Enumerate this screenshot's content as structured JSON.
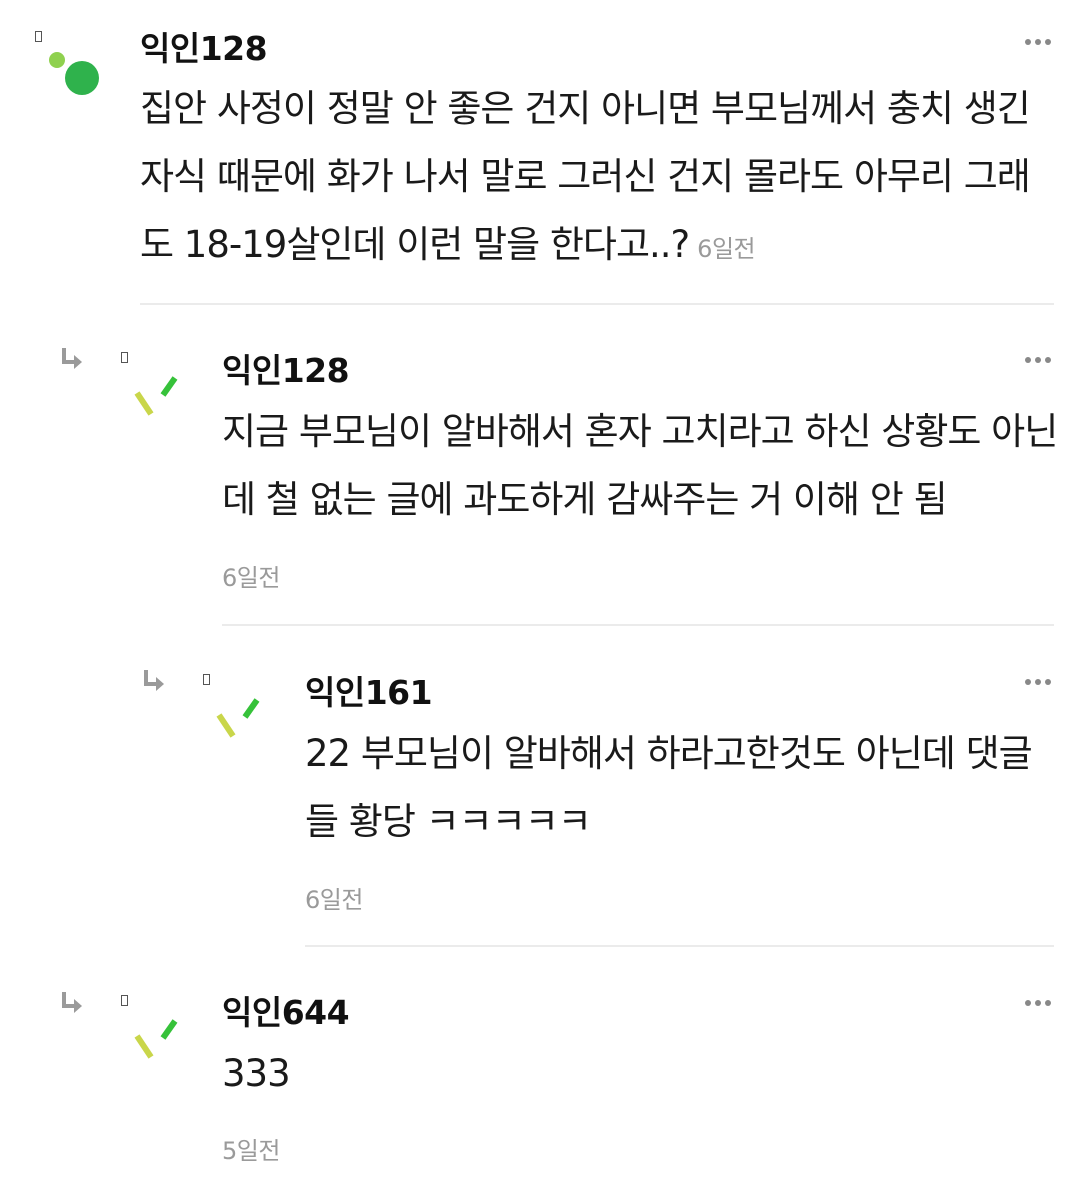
{
  "comments": [
    {
      "username": "익인128",
      "text": "집안 사정이 정말 안 좋은 건지 아니면 부모님께서 충치 생긴 자식 때문에 화가 나서 말로 그러신 건지 몰라도 아무리 그래도 18-19살인데 이런 말을 한다고..?",
      "time": "6일전"
    },
    {
      "username": "익인128",
      "text": "지금 부모님이 알바해서 혼자 고치라고 하신 상황도 아닌데 철 없는 글에 과도하게 감싸주는 거 이해 안 됨",
      "time": "6일전"
    },
    {
      "username": "익인161",
      "text": "22 부모님이 알바해서 하라고한것도 아닌데 댓글들 황당 ㅋㅋㅋㅋㅋ",
      "time": "6일전"
    },
    {
      "username": "익인644",
      "text": "333",
      "time": "5일전"
    }
  ],
  "colors": {
    "avatar_green_light": "#8fd14f",
    "avatar_green_dark": "#2fb24c",
    "avatar_yellow": "#c9d64a",
    "avatar_green": "#36c23a",
    "timestamp": "#9a9a9a",
    "divider": "#ebebeb"
  }
}
